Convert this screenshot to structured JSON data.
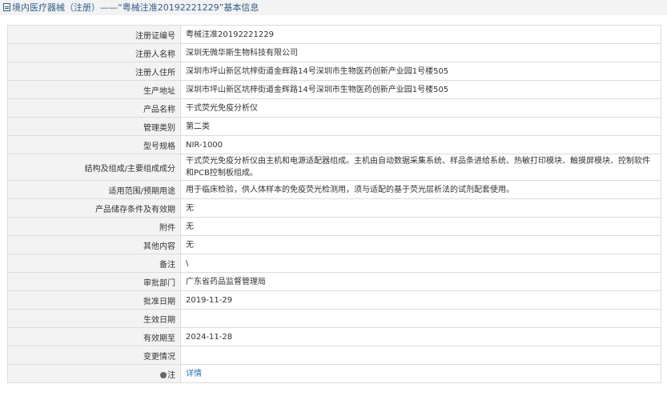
{
  "header": {
    "title": "境内医疗器械（注册）——“粤械注准20192221229”基本信息"
  },
  "rows": [
    {
      "label": "注册证编号",
      "value": "粤械注准20192221229"
    },
    {
      "label": "注册人名称",
      "value": "深圳无微华斯生物科技有限公司"
    },
    {
      "label": "注册人住所",
      "value": "深圳市坪山新区坑梓街道金辉路14号深圳市生物医药创新产业园1号楼505"
    },
    {
      "label": "生产地址",
      "value": "深圳市坪山新区坑梓街道金辉路14号深圳市生物医药创新产业园1号楼505"
    },
    {
      "label": "产品名称",
      "value": "干式荧光免疫分析仪"
    },
    {
      "label": "管理类别",
      "value": "第二类"
    },
    {
      "label": "型号规格",
      "value": "NIR-1000"
    },
    {
      "label": "结构及组成/主要组成成分",
      "value": "干式荧光免疫分析仪由主机和电源适配器组成。主机由自动数据采集系统、样品条进给系统、热敏打印模块、触摸屏模块、控制软件和PCB控制板组成。"
    },
    {
      "label": "适用范围/预期用途",
      "value": "用于临床检验，供人体样本的免疫荧光检测用，须与适配的基于荧光层析法的试剂配套使用。"
    },
    {
      "label": "产品储存条件及有效期",
      "value": "无"
    },
    {
      "label": "附件",
      "value": "无"
    },
    {
      "label": "其他内容",
      "value": "无"
    },
    {
      "label": "备注",
      "value": "\\"
    },
    {
      "label": "审批部门",
      "value": "广东省药品监督管理局"
    },
    {
      "label": "批准日期",
      "value": "2019-11-29"
    },
    {
      "label": "生效日期",
      "value": ""
    },
    {
      "label": "有效期至",
      "value": "2024-11-28"
    },
    {
      "label": "变更情况",
      "value": ""
    },
    {
      "label": "注",
      "value": "详情"
    }
  ]
}
